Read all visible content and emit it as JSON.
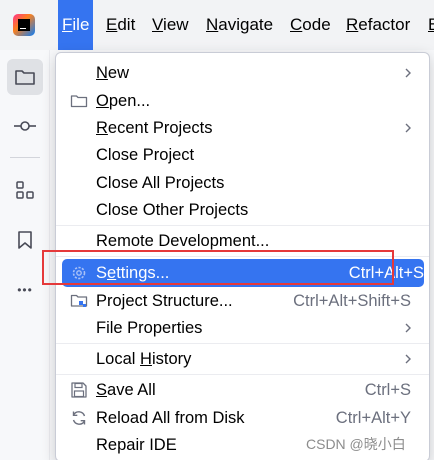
{
  "menubar": {
    "items": [
      {
        "mnemonic": "F",
        "rest": "ile"
      },
      {
        "mnemonic": "E",
        "rest": "dit"
      },
      {
        "mnemonic": "V",
        "rest": "iew"
      },
      {
        "mnemonic": "N",
        "rest": "avigate"
      },
      {
        "mnemonic": "C",
        "rest": "ode"
      },
      {
        "mnemonic": "R",
        "rest": "efactor"
      },
      {
        "mnemonic": "B",
        "rest": ""
      }
    ],
    "active_index": 0
  },
  "toolstrip": {
    "icons": [
      "folder-icon",
      "commit-icon",
      "structure-icon",
      "bookmark-icon",
      "more-icon"
    ],
    "more_glyph": "•••"
  },
  "file_menu": {
    "new": {
      "mn": "N",
      "rest": "ew"
    },
    "open": {
      "mn": "O",
      "rest": "pen..."
    },
    "recent": {
      "mn": "R",
      "rest": "ecent Projects"
    },
    "close_project": "Close Project",
    "close_all": "Close All Projects",
    "close_other": "Close Other Projects",
    "remote_dev": "Remote Development...",
    "settings": {
      "pre": "S",
      "mn": "e",
      "rest": "ttings...",
      "shortcut": "Ctrl+Alt+S"
    },
    "project_structure": {
      "label": "Project Structure...",
      "shortcut": "Ctrl+Alt+Shift+S"
    },
    "file_properties": "File Properties",
    "local_history": {
      "pre": "Local ",
      "mn": "H",
      "rest": "istory"
    },
    "save_all": {
      "mn": "S",
      "rest": "ave All",
      "shortcut": "Ctrl+S"
    },
    "reload": {
      "label": "Reload All from Disk",
      "shortcut": "Ctrl+Alt+Y"
    },
    "repair": "Repair IDE"
  },
  "watermark": "CSDN @晓小白",
  "colors": {
    "accent": "#3574f0",
    "annotation": "#e5393a"
  }
}
